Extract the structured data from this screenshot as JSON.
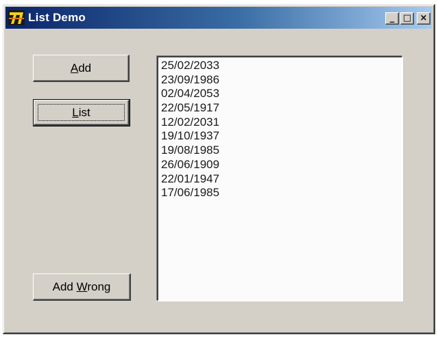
{
  "window": {
    "title": "List Demo",
    "minimize_glyph": "_",
    "maximize_glyph": "□",
    "close_glyph": "×"
  },
  "buttons": {
    "add": {
      "prefix": "",
      "accel": "A",
      "suffix": "dd"
    },
    "list": {
      "prefix": "",
      "accel": "L",
      "suffix": "ist"
    },
    "add_wrong": {
      "prefix": "Add ",
      "accel": "W",
      "suffix": "rong"
    }
  },
  "listbox": {
    "items": [
      "25/02/2033",
      "23/09/1986",
      "02/04/2053",
      "22/05/1917",
      "12/02/2031",
      "19/10/1937",
      "19/08/1985",
      "26/06/1909",
      "22/01/1947",
      "17/06/1985"
    ]
  },
  "colors": {
    "titlebar_start": "#0a246a",
    "titlebar_end": "#a6caf0",
    "face": "#d4d0c8"
  },
  "icons": {
    "app": "delphi-app-icon"
  }
}
